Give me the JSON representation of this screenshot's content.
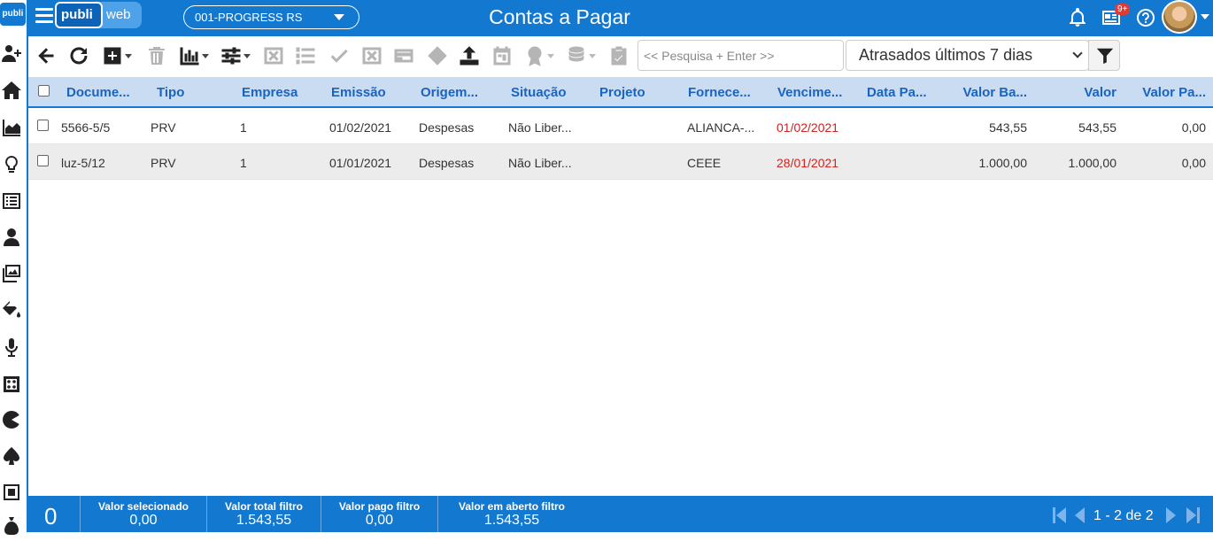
{
  "brand": {
    "side_logo": "publi",
    "name_a": "publi",
    "name_b": "web"
  },
  "company_select": {
    "value": "001-PROGRESS RS"
  },
  "page_title": "Contas a Pagar",
  "notifications_badge": "9+",
  "sidebar": {
    "icons": [
      "add-user-icon",
      "home-icon",
      "area-chart-icon",
      "lightbulb-icon",
      "list-icon",
      "user-icon",
      "images-icon",
      "paint-bucket-icon",
      "microphone-icon",
      "dice-icon",
      "pacman-icon",
      "spade-icon",
      "stop-square-icon",
      "money-bag-icon"
    ]
  },
  "toolbar": {
    "search_placeholder": "<< Pesquisa + Enter >>",
    "filter_value": "Atrasados últimos 7 dias"
  },
  "grid": {
    "columns": [
      "Docume...",
      "Tipo",
      "Empresa",
      "Emissão",
      "Origem...",
      "Situação",
      "Projeto",
      "Fornece...",
      "Vencime...",
      "Data Pa...",
      "Valor Ba...",
      "Valor",
      "Valor Pa..."
    ],
    "rows": [
      {
        "documento": "5566-5/5",
        "tipo": "PRV",
        "empresa": "1",
        "emissao": "01/02/2021",
        "origem": "Despesas",
        "situacao": "Não Liber...",
        "projeto": "",
        "fornecedor": "ALIANCA-...",
        "vencimento": "01/02/2021",
        "data_pagamento": "",
        "valor_base": "543,55",
        "valor": "543,55",
        "valor_pago": "0,00"
      },
      {
        "documento": "luz-5/12",
        "tipo": "PRV",
        "empresa": "1",
        "emissao": "01/01/2021",
        "origem": "Despesas",
        "situacao": "Não Liber...",
        "projeto": "",
        "fornecedor": "CEEE",
        "vencimento": "28/01/2021",
        "data_pagamento": "",
        "valor_base": "1.000,00",
        "valor": "1.000,00",
        "valor_pago": "0,00"
      }
    ]
  },
  "footer": {
    "selected_count": "0",
    "valor_selecionado_label": "Valor selecionado",
    "valor_selecionado": "0,00",
    "valor_total_label": "Valor total filtro",
    "valor_total": "1.543,55",
    "valor_pago_label": "Valor pago filtro",
    "valor_pago": "0,00",
    "valor_aberto_label": "Valor em aberto filtro",
    "valor_aberto": "1.543,55",
    "pagination": "1 - 2 de 2"
  },
  "colors": {
    "primary": "#1378cf",
    "header_bg": "#c9dcf2",
    "header_text": "#1a64c0",
    "overdue": "#d32020"
  }
}
